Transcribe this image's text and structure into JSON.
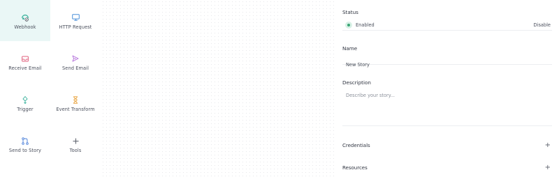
{
  "palette": {
    "items": [
      {
        "label": "Webhook",
        "icon": "webhook-icon"
      },
      {
        "label": "HTTP Request",
        "icon": "monitor-icon"
      },
      {
        "label": "Receive Email",
        "icon": "inbox-icon"
      },
      {
        "label": "Send Email",
        "icon": "send-icon"
      },
      {
        "label": "Trigger",
        "icon": "trigger-icon"
      },
      {
        "label": "Event Transform",
        "icon": "hourglass-icon"
      },
      {
        "label": "Send to Story",
        "icon": "branch-icon"
      },
      {
        "label": "Tools",
        "icon": "plus-icon"
      }
    ]
  },
  "panel": {
    "status": {
      "label": "Status",
      "value": "Enabled",
      "action": "Disable"
    },
    "name": {
      "label": "Name",
      "value": "New Story"
    },
    "description": {
      "label": "Description",
      "placeholder": "Describe your story..."
    },
    "credentials": {
      "label": "Credentials",
      "icon": "plus-icon"
    },
    "resources": {
      "label": "Resources",
      "icon": "plus-icon"
    }
  },
  "colors": {
    "active_tile_bg": "#eaf7f6",
    "webhook": "#3db39e",
    "http": "#4a90d9",
    "email": "#e0607e",
    "send": "#b06ad9",
    "trigger": "#3db39e",
    "transform": "#e8a33d",
    "story": "#4a7fd9",
    "status_dot": "#3aa574"
  }
}
